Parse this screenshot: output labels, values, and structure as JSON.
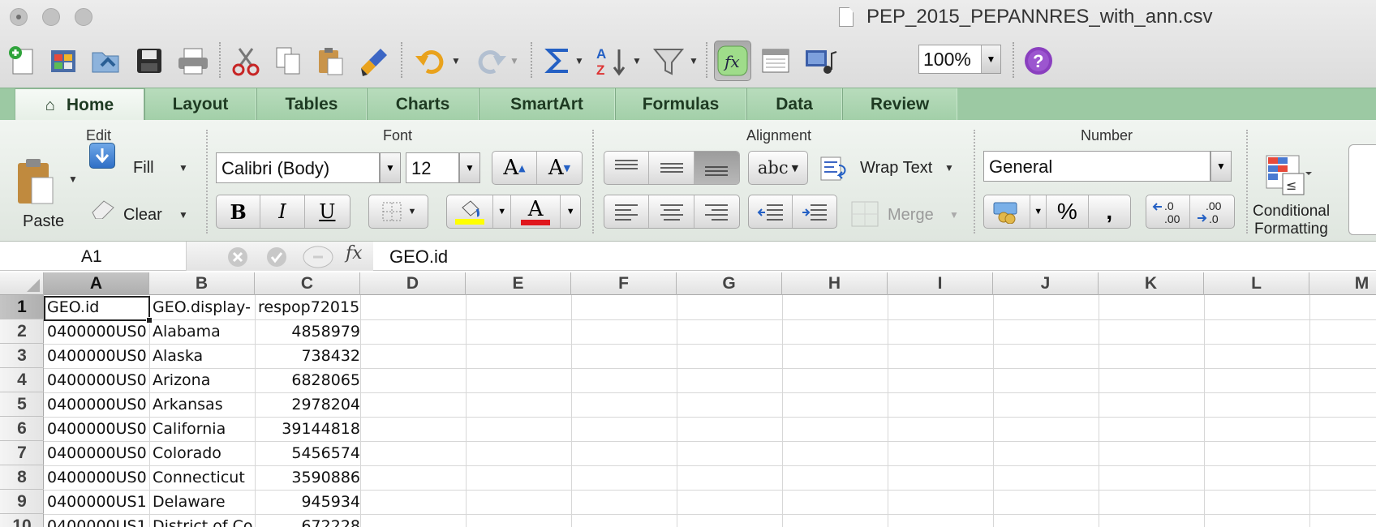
{
  "window": {
    "title": "PEP_2015_PEPANNRES_with_ann.csv"
  },
  "toolbar": {
    "buttons": [
      {
        "name": "new-icon"
      },
      {
        "name": "templates-icon"
      },
      {
        "name": "open-icon"
      },
      {
        "name": "save-icon"
      },
      {
        "name": "print-icon"
      },
      {
        "name": "cut-icon"
      },
      {
        "name": "copy-icon"
      },
      {
        "name": "paste-icon"
      },
      {
        "name": "format-painter-icon"
      },
      {
        "name": "undo-icon"
      },
      {
        "name": "redo-icon"
      },
      {
        "name": "autosum-icon"
      },
      {
        "name": "sort-icon"
      },
      {
        "name": "filter-icon"
      },
      {
        "name": "formula-builder-icon"
      },
      {
        "name": "show-hide-toolbox-icon"
      },
      {
        "name": "media-browser-icon"
      },
      {
        "name": "help-icon"
      }
    ],
    "zoom": "100%"
  },
  "ribbon": {
    "tabs": [
      "Home",
      "Layout",
      "Tables",
      "Charts",
      "SmartArt",
      "Formulas",
      "Data",
      "Review"
    ],
    "active_tab": "Home",
    "groups": {
      "edit": {
        "title": "Edit",
        "paste": "Paste",
        "fill": "Fill",
        "clear": "Clear"
      },
      "font": {
        "title": "Font",
        "font_name": "Calibri (Body)",
        "font_size": "12",
        "bold": "B",
        "italic": "I",
        "underline": "U",
        "grow": "A",
        "shrink": "A",
        "font_color_glyph": "A",
        "highlight_color": "#ffff00",
        "font_color": "#e0161d"
      },
      "alignment": {
        "title": "Alignment",
        "orientation": "abc",
        "wrap_text": "Wrap Text",
        "merge": "Merge"
      },
      "number": {
        "title": "Number",
        "format": "General",
        "percent": "%",
        "comma": ",",
        "inc_decimal": ".0\n.00",
        "dec_decimal": ".00\n.0"
      },
      "format": {
        "conditional_formatting_line1": "Conditional",
        "conditional_formatting_line2": "Formatting"
      }
    }
  },
  "formula_bar": {
    "cell_ref": "A1",
    "fx": "fx",
    "content": "GEO.id"
  },
  "sheet": {
    "columns": [
      "A",
      "B",
      "C",
      "D",
      "E",
      "F",
      "G",
      "H",
      "I",
      "J",
      "K",
      "L",
      "M"
    ],
    "selected_column": "A",
    "selected_row": "1",
    "rows": [
      {
        "num": "1",
        "a": "GEO.id",
        "b": "GEO.display-",
        "c": "respop72015"
      },
      {
        "num": "2",
        "a": "0400000US0",
        "b": "Alabama",
        "c": "4858979"
      },
      {
        "num": "3",
        "a": "0400000US0",
        "b": "Alaska",
        "c": "738432"
      },
      {
        "num": "4",
        "a": "0400000US0",
        "b": "Arizona",
        "c": "6828065"
      },
      {
        "num": "5",
        "a": "0400000US0",
        "b": "Arkansas",
        "c": "2978204"
      },
      {
        "num": "6",
        "a": "0400000US0",
        "b": "California",
        "c": "39144818"
      },
      {
        "num": "7",
        "a": "0400000US0",
        "b": "Colorado",
        "c": "5456574"
      },
      {
        "num": "8",
        "a": "0400000US0",
        "b": "Connecticut",
        "c": "3590886"
      },
      {
        "num": "9",
        "a": "0400000US1",
        "b": "Delaware",
        "c": "945934"
      },
      {
        "num": "10",
        "a": "0400000US1",
        "b": "District of Co",
        "c": "672228"
      }
    ]
  }
}
